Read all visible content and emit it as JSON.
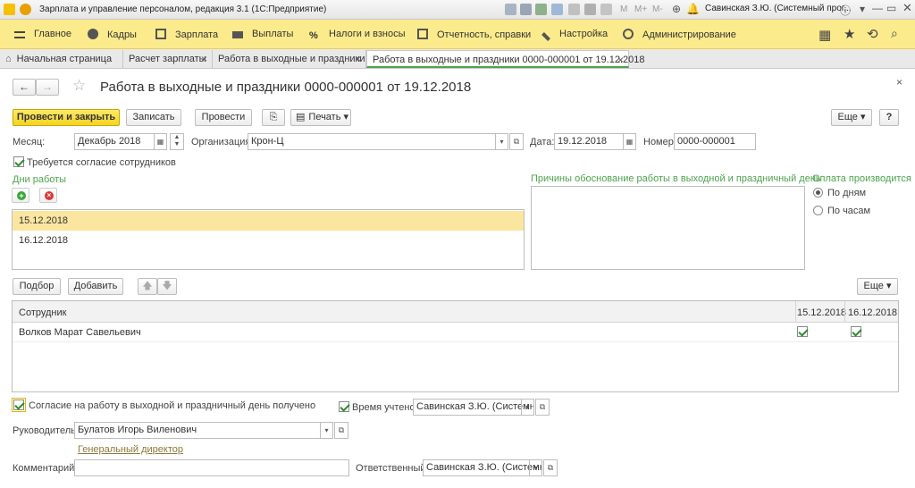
{
  "window": {
    "title": "Зарплата и управление персоналом, редакция 3.1  (1С:Предприятие)",
    "user": "Савинская З.Ю. (Системный прог..."
  },
  "menu": [
    "Главное",
    "Кадры",
    "Зарплата",
    "Выплаты",
    "Налоги и взносы",
    "Отчетность, справки",
    "Настройка",
    "Администрирование"
  ],
  "tabs": [
    {
      "label": "Начальная страница"
    },
    {
      "label": "Расчет зарплаты"
    },
    {
      "label": "Работа в выходные и праздники"
    },
    {
      "label": "Работа в выходные и праздники 0000-000001 от 19.12.2018"
    }
  ],
  "doc": {
    "title": "Работа в выходные и праздники 0000-000001 от 19.12.2018"
  },
  "toolbar": {
    "post_close": "Провести и закрыть",
    "save": "Записать",
    "post": "Провести",
    "print": "Печать",
    "more": "Еще",
    "help": "?"
  },
  "form": {
    "month_label": "Месяц:",
    "month_value": "Декабрь 2018",
    "org_label": "Организация:",
    "org_value": "Крон-Ц",
    "date_label": "Дата:",
    "date_value": "19.12.2018",
    "number_label": "Номер:",
    "number_value": "0000-000001",
    "consent_required": "Требуется согласие сотрудников",
    "days_title": "Дни работы",
    "reasons_title": "Причины обоснование работы в выходной и праздничный день",
    "payment_title": "Оплата производится",
    "payment_days": "По дням",
    "payment_hours": "По часам",
    "days": [
      "15.12.2018",
      "16.12.2018"
    ]
  },
  "table": {
    "pick": "Подбор",
    "add": "Добавить",
    "more": "Еще",
    "col_employee": "Сотрудник",
    "col_d1": "15.12.2018",
    "col_d2": "16.12.2018",
    "rows": [
      {
        "name": "Волков Марат Савельевич"
      }
    ]
  },
  "footer": {
    "consent_received": "Согласие на работу в выходной и праздничный день получено",
    "time_counted": "Время учтено",
    "time_user": "Савинская З.Ю. (Системн",
    "head_label": "Руководитель:",
    "head_value": "Булатов Игорь Виленович",
    "head_position": "Генеральный директор",
    "comment_label": "Комментарий:",
    "comment_value": "",
    "responsible_label": "Ответственный:",
    "responsible_value": "Савинская З.Ю. (Системн"
  }
}
